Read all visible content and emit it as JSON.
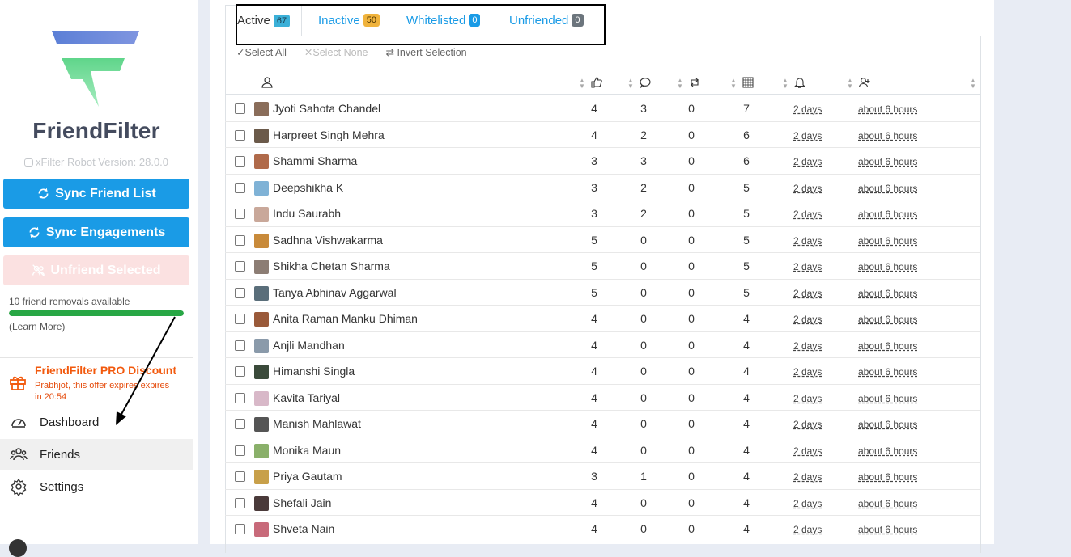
{
  "sidebar": {
    "brand": "FriendFilter",
    "version": "xFilter Robot Version: 28.0.0",
    "sync_friend_list": "Sync Friend List",
    "sync_engagements": "Sync Engagements",
    "unfriend_selected": "Unfriend Selected",
    "removals_text": "10 friend removals available",
    "removals_progress": 1.0,
    "learn_more": "(Learn More)",
    "promo_title": "FriendFilter PRO Discount",
    "promo_text": "Prabhjot, this offer expires expires in 20:54",
    "nav": {
      "dashboard": "Dashboard",
      "friends": "Friends",
      "settings": "Settings"
    },
    "colors": {
      "primary": "#1a9be6",
      "promo": "#f2590d",
      "progress": "#28a745",
      "brand_text": "#444b5e"
    }
  },
  "tabs": [
    {
      "label": "Active",
      "count": "67",
      "badge_bg": "#3bb0d8",
      "badge_fg": "#1a3a4a"
    },
    {
      "label": "Inactive",
      "count": "50",
      "badge_bg": "#f0b33c",
      "badge_fg": "#4a3300"
    },
    {
      "label": "Whitelisted",
      "count": "0",
      "badge_bg": "#1a9be6",
      "badge_fg": "#ffffff"
    },
    {
      "label": "Unfriended",
      "count": "0",
      "badge_bg": "#6c757d",
      "badge_fg": "#ffffff"
    }
  ],
  "selection": {
    "select_all": "Select All",
    "select_none": "Select None",
    "invert": "Invert Selection"
  },
  "columns": [
    "person-icon",
    "like-icon",
    "comment-icon",
    "share-icon",
    "reaction-grid-icon",
    "bell-icon",
    "add-friend-icon"
  ],
  "rows": [
    {
      "name": "Jyoti Sahota Chandel",
      "likes": "4",
      "comments": "3",
      "shares": "0",
      "total": "7",
      "last": "2 days",
      "added": "about 6 hours",
      "avatar": "#8a6d5a"
    },
    {
      "name": "Harpreet Singh Mehra",
      "likes": "4",
      "comments": "2",
      "shares": "0",
      "total": "6",
      "last": "2 days",
      "added": "about 6 hours",
      "avatar": "#6b5a4a"
    },
    {
      "name": "Shammi Sharma",
      "likes": "3",
      "comments": "3",
      "shares": "0",
      "total": "6",
      "last": "2 days",
      "added": "about 6 hours",
      "avatar": "#b06a4a"
    },
    {
      "name": "Deepshikha K",
      "likes": "3",
      "comments": "2",
      "shares": "0",
      "total": "5",
      "last": "2 days",
      "added": "about 6 hours",
      "avatar": "#7fb2d6"
    },
    {
      "name": "Indu Saurabh",
      "likes": "3",
      "comments": "2",
      "shares": "0",
      "total": "5",
      "last": "2 days",
      "added": "about 6 hours",
      "avatar": "#c9a89a"
    },
    {
      "name": "Sadhna Vishwakarma",
      "likes": "5",
      "comments": "0",
      "shares": "0",
      "total": "5",
      "last": "2 days",
      "added": "about 6 hours",
      "avatar": "#c88a3a"
    },
    {
      "name": "Shikha Chetan Sharma",
      "likes": "5",
      "comments": "0",
      "shares": "0",
      "total": "5",
      "last": "2 days",
      "added": "about 6 hours",
      "avatar": "#8c7d74"
    },
    {
      "name": "Tanya Abhinav Aggarwal",
      "likes": "5",
      "comments": "0",
      "shares": "0",
      "total": "5",
      "last": "2 days",
      "added": "about 6 hours",
      "avatar": "#5a6e7a"
    },
    {
      "name": "Anita Raman Manku Dhiman",
      "likes": "4",
      "comments": "0",
      "shares": "0",
      "total": "4",
      "last": "2 days",
      "added": "about 6 hours",
      "avatar": "#9a5a3a"
    },
    {
      "name": "Anjli Mandhan",
      "likes": "4",
      "comments": "0",
      "shares": "0",
      "total": "4",
      "last": "2 days",
      "added": "about 6 hours",
      "avatar": "#8a9aaa"
    },
    {
      "name": "Himanshi Singla",
      "likes": "4",
      "comments": "0",
      "shares": "0",
      "total": "4",
      "last": "2 days",
      "added": "about 6 hours",
      "avatar": "#3a4a3a"
    },
    {
      "name": "Kavita Tariyal",
      "likes": "4",
      "comments": "0",
      "shares": "0",
      "total": "4",
      "last": "2 days",
      "added": "about 6 hours",
      "avatar": "#d8b8c8"
    },
    {
      "name": "Manish Mahlawat",
      "likes": "4",
      "comments": "0",
      "shares": "0",
      "total": "4",
      "last": "2 days",
      "added": "about 6 hours",
      "avatar": "#555555"
    },
    {
      "name": "Monika Maun",
      "likes": "4",
      "comments": "0",
      "shares": "0",
      "total": "4",
      "last": "2 days",
      "added": "about 6 hours",
      "avatar": "#8ab06a"
    },
    {
      "name": "Priya Gautam",
      "likes": "3",
      "comments": "1",
      "shares": "0",
      "total": "4",
      "last": "2 days",
      "added": "about 6 hours",
      "avatar": "#c8a04a"
    },
    {
      "name": "Shefali Jain",
      "likes": "4",
      "comments": "0",
      "shares": "0",
      "total": "4",
      "last": "2 days",
      "added": "about 6 hours",
      "avatar": "#4a3a3a"
    },
    {
      "name": "Shveta Nain",
      "likes": "4",
      "comments": "0",
      "shares": "0",
      "total": "4",
      "last": "2 days",
      "added": "about 6 hours",
      "avatar": "#c86a7a"
    }
  ]
}
